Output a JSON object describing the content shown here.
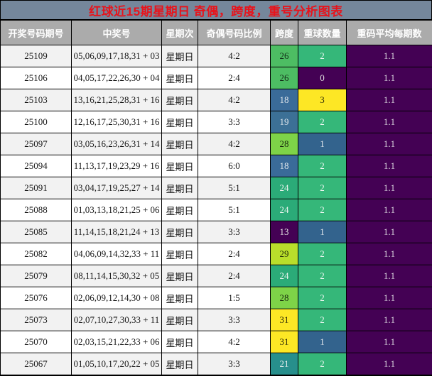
{
  "chart_data": {
    "type": "table",
    "title": "红球近15期星期日 奇偶，跨度，重号分析图表",
    "columns": [
      "开奖号码期号",
      "中奖号",
      "星期次",
      "奇偶号码比例",
      "跨度",
      "重球数量",
      "重码平均每期数"
    ],
    "rows": [
      {
        "period": "25109",
        "numbers": "05,06,09,17,18,31 + 03",
        "weekday": "星期日",
        "ratio": "4:2",
        "span": "26",
        "repeat": "2",
        "avg": "1.1"
      },
      {
        "period": "25106",
        "numbers": "04,05,17,22,26,30 + 04",
        "weekday": "星期日",
        "ratio": "2:4",
        "span": "26",
        "repeat": "0",
        "avg": "1.1"
      },
      {
        "period": "25103",
        "numbers": "13,16,21,25,28,31 + 16",
        "weekday": "星期日",
        "ratio": "4:2",
        "span": "18",
        "repeat": "3",
        "avg": "1.1"
      },
      {
        "period": "25100",
        "numbers": "12,16,17,25,30,31 + 16",
        "weekday": "星期日",
        "ratio": "3:3",
        "span": "19",
        "repeat": "2",
        "avg": "1.1"
      },
      {
        "period": "25097",
        "numbers": "03,05,16,23,26,31 + 14",
        "weekday": "星期日",
        "ratio": "4:2",
        "span": "28",
        "repeat": "1",
        "avg": "1.1"
      },
      {
        "period": "25094",
        "numbers": "11,13,17,19,23,29 + 16",
        "weekday": "星期日",
        "ratio": "6:0",
        "span": "18",
        "repeat": "2",
        "avg": "1.1"
      },
      {
        "period": "25091",
        "numbers": "03,04,17,19,25,27 + 14",
        "weekday": "星期日",
        "ratio": "5:1",
        "span": "24",
        "repeat": "2",
        "avg": "1.1"
      },
      {
        "period": "25088",
        "numbers": "01,03,13,18,21,25 + 06",
        "weekday": "星期日",
        "ratio": "5:1",
        "span": "24",
        "repeat": "2",
        "avg": "1.1"
      },
      {
        "period": "25085",
        "numbers": "11,14,15,18,21,24 + 13",
        "weekday": "星期日",
        "ratio": "3:3",
        "span": "13",
        "repeat": "1",
        "avg": "1.1"
      },
      {
        "period": "25082",
        "numbers": "04,06,09,14,32,33 + 11",
        "weekday": "星期日",
        "ratio": "2:4",
        "span": "29",
        "repeat": "2",
        "avg": "1.1"
      },
      {
        "period": "25079",
        "numbers": "08,11,14,15,30,32 + 05",
        "weekday": "星期日",
        "ratio": "2:4",
        "span": "24",
        "repeat": "2",
        "avg": "1.1"
      },
      {
        "period": "25076",
        "numbers": "02,06,09,12,14,30 + 08",
        "weekday": "星期日",
        "ratio": "1:5",
        "span": "28",
        "repeat": "2",
        "avg": "1.1"
      },
      {
        "period": "25073",
        "numbers": "02,07,10,27,30,33 + 11",
        "weekday": "星期日",
        "ratio": "3:3",
        "span": "31",
        "repeat": "2",
        "avg": "1.1"
      },
      {
        "period": "25070",
        "numbers": "02,03,15,21,22,33 + 06",
        "weekday": "星期日",
        "ratio": "4:2",
        "span": "31",
        "repeat": "1",
        "avg": "1.1"
      },
      {
        "period": "25067",
        "numbers": "01,05,10,17,20,22 + 05",
        "weekday": "星期日",
        "ratio": "3:3",
        "span": "21",
        "repeat": "2",
        "avg": "1.1"
      }
    ],
    "layout_hints": {
      "grid": "black 1px cell borders",
      "striping": "alternating light-gray/white rows",
      "value_coloring": "viridis-like scale on span and repeat columns"
    }
  },
  "colors": {
    "title_bg": "#75879B",
    "title_text": "#E8131B",
    "header_bg": "#ABABAB",
    "header_text": "#FFFFFF",
    "row_stripe": "#F2F2F2",
    "row_plain": "#FFFFFF",
    "span_map": {
      "13": {
        "bg": "#440154",
        "fg": "#E0E0E0"
      },
      "18": {
        "bg": "#3A6B99",
        "fg": "#DCE3EA"
      },
      "19": {
        "bg": "#3C7096",
        "fg": "#DCE3EA"
      },
      "21": {
        "bg": "#278F8C",
        "fg": "#E2ECEC"
      },
      "24": {
        "bg": "#2BAB78",
        "fg": "#E6F2EC"
      },
      "26": {
        "bg": "#4DBD63",
        "fg": "#14301A"
      },
      "28": {
        "bg": "#7ED348",
        "fg": "#1C3010"
      },
      "29": {
        "bg": "#B9DE2B",
        "fg": "#2A330A"
      },
      "31": {
        "bg": "#FDE725",
        "fg": "#333108"
      }
    },
    "repeat_map": {
      "0": {
        "bg": "#440154",
        "fg": "#E0E0E0"
      },
      "1": {
        "bg": "#33638D",
        "fg": "#DCE3EA"
      },
      "2": {
        "bg": "#35B779",
        "fg": "#EAF6F0"
      },
      "3": {
        "bg": "#FDE725",
        "fg": "#333108"
      }
    },
    "avg": {
      "bg": "#440154",
      "fg": "#D8D2DC"
    }
  }
}
